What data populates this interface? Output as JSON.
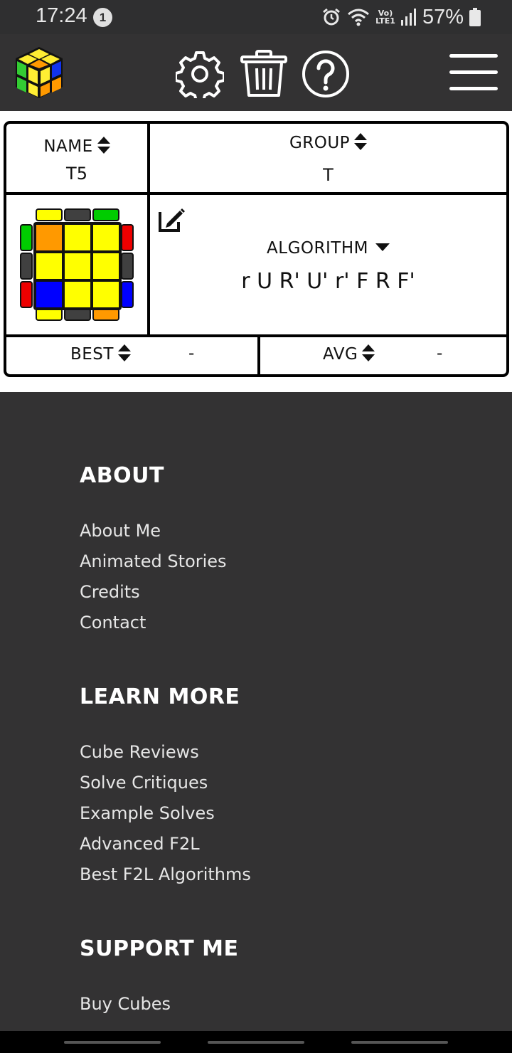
{
  "status_bar": {
    "time": "17:24",
    "notification_count": "1",
    "lte_top": "Vo)",
    "lte_bottom": "LTE1",
    "battery_percent": "57%"
  },
  "header": {
    "icons": [
      "cube-logo",
      "gear-icon",
      "trash-icon",
      "help-icon",
      "menu-icon"
    ]
  },
  "card": {
    "name_header": "NAME",
    "name_value": "T5",
    "group_header": "GROUP",
    "group_value": "T",
    "algorithm_header": "ALGORITHM",
    "algorithm_value": "r U R' U' r' F R F'",
    "best_label": "BEST",
    "best_value": "-",
    "avg_label": "AVG",
    "avg_value": "-"
  },
  "footer": {
    "about": {
      "title": "ABOUT",
      "links": [
        "About Me",
        "Animated Stories",
        "Credits",
        "Contact"
      ]
    },
    "learn_more": {
      "title": "LEARN MORE",
      "links": [
        "Cube Reviews",
        "Solve Critiques",
        "Example Solves",
        "Advanced F2L",
        "Best F2L Algorithms"
      ]
    },
    "support_me": {
      "title": "SUPPORT ME",
      "links": [
        "Buy Cubes"
      ]
    }
  },
  "colors": {
    "background": "#333233",
    "card_border": "#000000",
    "cube_yellow": "#ffff00",
    "cube_orange": "#ff9900",
    "cube_green": "#00cc00",
    "cube_red": "#ee0000",
    "cube_blue": "#0000ff",
    "cube_gray": "#404040"
  }
}
